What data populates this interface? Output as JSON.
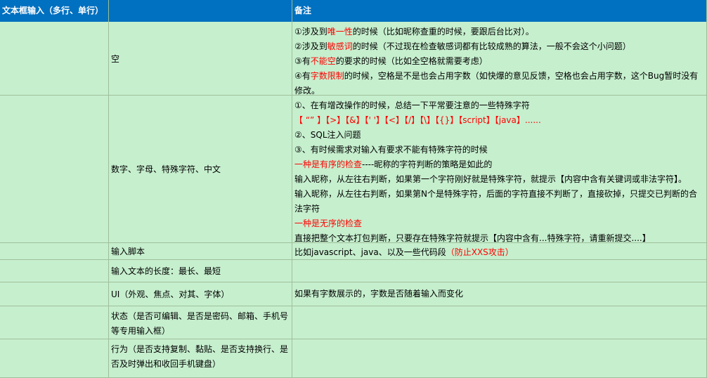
{
  "header": {
    "col_a": "文本框输入（多行、单行）",
    "col_b": "",
    "col_c": "备注"
  },
  "rows": [
    {
      "item": "空",
      "notes": [
        [
          {
            "t": "①涉及到"
          },
          {
            "t": "唯一性",
            "red": true
          },
          {
            "t": "的时候（比如昵称查重的时候，要跟后台比对）。"
          }
        ],
        [
          {
            "t": "②涉及到"
          },
          {
            "t": "敏感词",
            "red": true
          },
          {
            "t": "的时候（不过现在检查敏感词都有比较成熟的算法，一般不会这个小问题）"
          }
        ],
        [
          {
            "t": "③有"
          },
          {
            "t": "不能空",
            "red": true
          },
          {
            "t": "的要求的时候（比如全空格就需要考虑）"
          }
        ],
        [
          {
            "t": "④有"
          },
          {
            "t": "字数限制",
            "red": true
          },
          {
            "t": "的时候，空格是不是也会占用字数（如快爆的意见反馈，空格也会占用字数，这个Bug暂时没有"
          }
        ],
        [
          {
            "t": "修改。"
          }
        ]
      ]
    },
    {
      "item": "数字、字母、特殊字符、中文",
      "notes": [
        [
          {
            "t": "①、在有增改操作的时候，总结一下平常要注意的一些特殊字符"
          }
        ],
        [
          {
            "t": "【 “” 】【>】【&】【'  '】【<】【/】【\\】【{}】【script】【java】......",
            "red": true
          }
        ],
        [
          {
            "t": "②、SQL注入问题"
          }
        ],
        [
          {
            "t": "③、有时候需求对输入有要求不能有特殊字符的时候"
          }
        ],
        [
          {
            "t": "一种是有序的检查",
            "red": true
          },
          {
            "t": "----昵称的字符判断的策略是如此的"
          }
        ],
        [
          {
            "t": "输入昵称，从左往右判断，如果第一个字符刚好就是特殊字符，就提示【内容中含有关键词或非法字符】。"
          }
        ],
        [
          {
            "t": "输入昵称，从左往右判断，如果第N个是特殊字符，后面的字符直接不判断了，直接砍掉，只提交已判断的合"
          }
        ],
        [
          {
            "t": "法字符"
          }
        ],
        [
          {
            "t": "一种是无序的检查",
            "red": true
          }
        ],
        [
          {
            "t": "直接把整个文本打包判断，只要存在特殊字符就提示【内容中含有...特殊字符，请重新提交....】"
          }
        ]
      ]
    },
    {
      "item": "输入脚本",
      "notes": [
        [
          {
            "t": "比如javascript、java、以及一些代码段"
          },
          {
            "t": "（防止XXS攻击）",
            "red": true
          }
        ]
      ]
    },
    {
      "item": "输入文本的长度：最长、最短",
      "notes": []
    },
    {
      "item": "UI（外观、焦点、对其、字体）",
      "notes": [
        [
          {
            "t": "如果有字数展示的，字数是否随着输入而变化"
          }
        ]
      ]
    },
    {
      "item_lines": [
        "状态（是否可编辑、是否是密码、邮箱、手机号",
        "等专用输入框）"
      ],
      "notes": []
    },
    {
      "item_lines": [
        "行为（是否支持复制、黏贴、是否支持换行、是",
        "否及时弹出和收回手机键盘）"
      ],
      "notes": []
    }
  ]
}
